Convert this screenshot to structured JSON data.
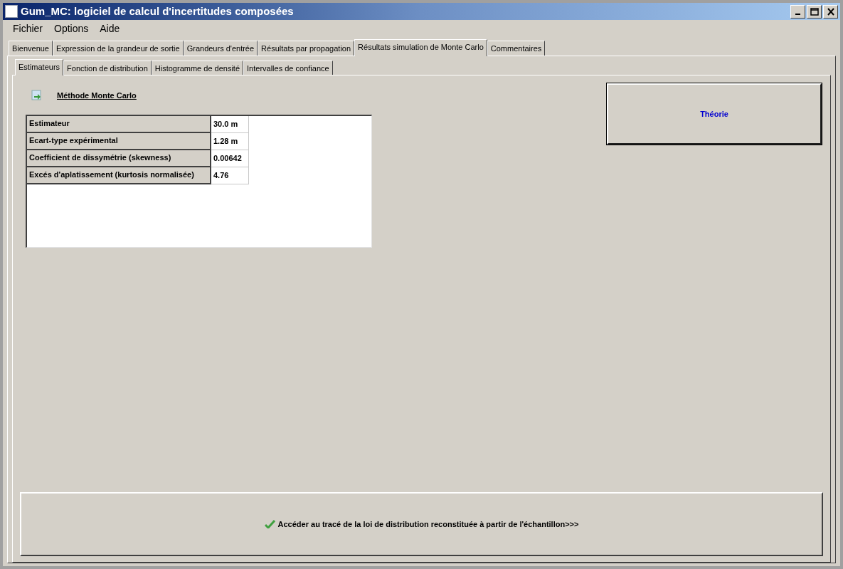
{
  "window": {
    "title": "Gum_MC: logiciel de calcul d'incertitudes composées"
  },
  "menu": [
    "Fichier",
    "Options",
    "Aide"
  ],
  "tabs": [
    {
      "label": "Bienvenue",
      "selected": false
    },
    {
      "label": "Expression de la grandeur de sortie",
      "selected": false
    },
    {
      "label": "Grandeurs d'entrée",
      "selected": false
    },
    {
      "label": "Résultats par propagation",
      "selected": false
    },
    {
      "label": "Résultats simulation de Monte Carlo",
      "selected": true
    },
    {
      "label": "Commentaires",
      "selected": false
    }
  ],
  "subtabs": [
    {
      "label": "Estimateurs",
      "selected": true
    },
    {
      "label": "Fonction de distribution",
      "selected": false
    },
    {
      "label": "Histogramme de densité",
      "selected": false
    },
    {
      "label": "Intervalles de confiance",
      "selected": false
    }
  ],
  "section_title": "Méthode Monte Carlo",
  "table": {
    "rows": [
      {
        "label": "Estimateur",
        "value": "30.0 m"
      },
      {
        "label": "Ecart-type expérimental",
        "value": "1.28 m"
      },
      {
        "label": "Coefficient de dissymétrie (skewness)",
        "value": "0.00642"
      },
      {
        "label": "Excés d'aplatissement (kurtosis normalisée)",
        "value": "4.76"
      }
    ]
  },
  "theory_button": "Théorie",
  "bottom_button": "Accéder au tracé de la loi de distribution reconstituée à partir de l'échantillon>>>"
}
